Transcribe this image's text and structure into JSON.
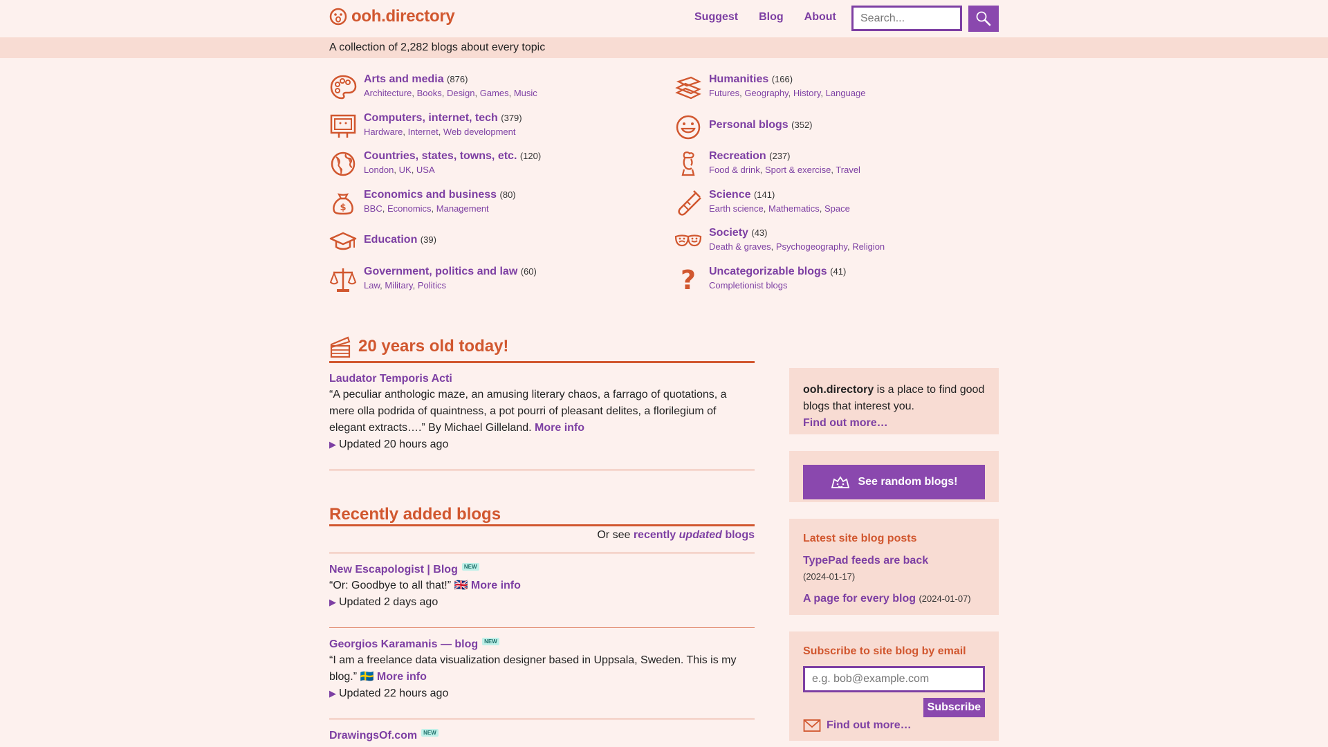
{
  "header": {
    "site_name": "ooh.directory",
    "nav": [
      "Suggest",
      "Blog",
      "About"
    ],
    "search_placeholder": "Search..."
  },
  "tagline": "A collection of 2,282 blogs about every topic",
  "categories": [
    {
      "title": "Arts and media",
      "count": "(876)",
      "subs": [
        "Architecture",
        "Books",
        "Design",
        "Games",
        "Music"
      ],
      "icon": "palette-icon"
    },
    {
      "title": "Computers, internet, tech",
      "count": "(379)",
      "subs": [
        "Hardware",
        "Internet",
        "Web development"
      ],
      "icon": "computer-icon"
    },
    {
      "title": "Countries, states, towns, etc.",
      "count": "(120)",
      "subs": [
        "London",
        "UK",
        "USA"
      ],
      "icon": "globe-icon"
    },
    {
      "title": "Economics and business",
      "count": "(80)",
      "subs": [
        "BBC",
        "Economics",
        "Management"
      ],
      "icon": "money-bag-icon"
    },
    {
      "title": "Education",
      "count": "(39)",
      "subs": [],
      "icon": "graduation-cap-icon"
    },
    {
      "title": "Government, politics and law",
      "count": "(60)",
      "subs": [
        "Law",
        "Military",
        "Politics"
      ],
      "icon": "scales-icon"
    },
    {
      "title": "Humanities",
      "count": "(166)",
      "subs": [
        "Futures",
        "Geography",
        "History",
        "Language"
      ],
      "icon": "books-icon"
    },
    {
      "title": "Personal blogs",
      "count": "(352)",
      "subs": [],
      "icon": "smiley-icon"
    },
    {
      "title": "Recreation",
      "count": "(237)",
      "subs": [
        "Food & drink",
        "Sport & exercise",
        "Travel"
      ],
      "icon": "chef-icon"
    },
    {
      "title": "Science",
      "count": "(141)",
      "subs": [
        "Earth science",
        "Mathematics",
        "Space"
      ],
      "icon": "test-tube-icon"
    },
    {
      "title": "Society",
      "count": "(43)",
      "subs": [
        "Death & graves",
        "Psychogeography",
        "Religion"
      ],
      "icon": "theatre-masks-icon"
    },
    {
      "title": "Uncategorizable blogs",
      "count": "(41)",
      "subs": [
        "Completionist blogs"
      ],
      "icon": "question-mark-icon"
    }
  ],
  "anniversary": {
    "heading": "20 years old today!",
    "blog_title": "Laudator Temporis Acti",
    "description": "“A peculiar anthologic maze, an amusing literary chaos, a farrago of quotations, a mere olla podrida of quaintness, a pot pourri of pleasant delites, a florilegium of elegant extracts….” By Michael Gilleland.",
    "more_info": "More info",
    "updated": "Updated 20 hours ago"
  },
  "recent": {
    "heading": "Recently added blogs",
    "or_see": "Or see",
    "recently": "recently",
    "updated_word": "updated",
    "blogs": "blogs",
    "new_label": "NEW",
    "items": [
      {
        "title": "New Escapologist | Blog",
        "description": "“Or: Goodbye to all that!”",
        "flag": "🇬🇧",
        "more_info": "More info",
        "updated": "Updated 2 days ago"
      },
      {
        "title": "Georgios Karamanis — blog",
        "description": "“I am a freelance data visualization designer  based in Uppsala, Sweden. This is my blog.”",
        "flag": "🇸🇪",
        "more_info": "More info",
        "updated": "Updated 22 hours ago"
      },
      {
        "title": "DrawingsOf.com",
        "description": "",
        "flag": "",
        "more_info": "",
        "updated": ""
      }
    ]
  },
  "sidebar": {
    "about_strong": "ooh.directory",
    "about_text": " is a place to find good blogs that interest you.",
    "find_out_more": "Find out more…",
    "random_button": "See random blogs!",
    "latest_heading": "Latest site blog posts",
    "posts": [
      {
        "title": "TypePad feeds are back",
        "date": "(2024-01-17)"
      },
      {
        "title": "A page for every blog",
        "date": "(2024-01-07)"
      }
    ],
    "subscribe_heading": "Subscribe to site blog by email",
    "email_placeholder": "e.g. bob@example.com",
    "subscribe_button": "Subscribe",
    "subscribe_find_out_more": "Find out more…"
  },
  "colors": {
    "brand_orange": "#d1572f",
    "brand_purple": "#7d3fa3",
    "background": "#fdf1ee",
    "panel": "#f8dcd3"
  }
}
